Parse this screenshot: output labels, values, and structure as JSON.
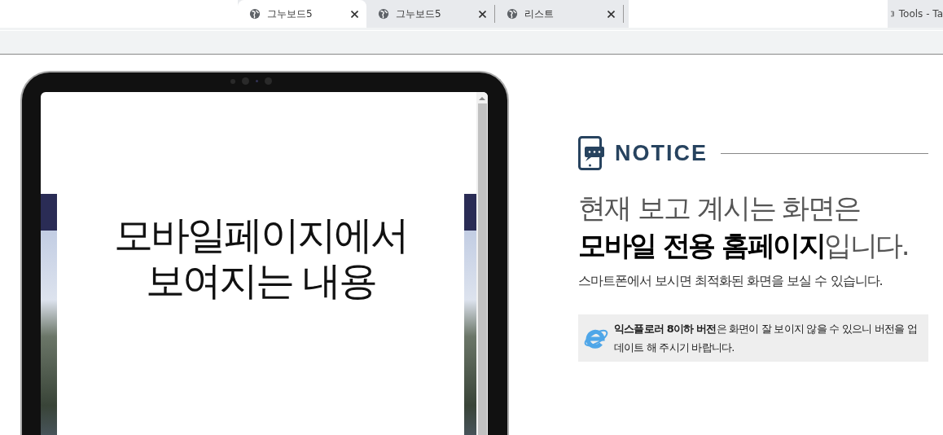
{
  "tabs": [
    {
      "title": "그누보드5",
      "selected": true
    },
    {
      "title": "그누보드5",
      "selected": false
    },
    {
      "title": "리스트",
      "selected": false
    }
  ],
  "bookmark": {
    "label": "Tools - Ta"
  },
  "device_screen": {
    "heading_lines": [
      "모바일페이지에서",
      "보여지는 내용"
    ]
  },
  "notice": {
    "title": "NOTICE",
    "headline_1": "현재 보고 계시는 화면은",
    "headline_2": "**모바일 전용 홈페이지**입니다.",
    "subtext": "스마트폰에서 보시면 최적화된 화면을 보실 수 있습니다.",
    "ie_warning": "**익스플로러 8이하 버전**은 화면이 잘 보이지 않을 수 있으니 버전을 업데이트 해 주시기 바랍니다."
  }
}
